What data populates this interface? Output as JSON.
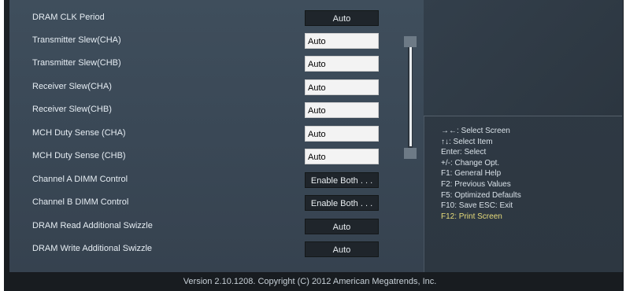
{
  "settings": [
    {
      "label": "DRAM CLK Period",
      "value": "Auto",
      "style": "dark"
    },
    {
      "label": "Transmitter Slew(CHA)",
      "value": "Auto",
      "style": "light"
    },
    {
      "label": "Transmitter Slew(CHB)",
      "value": "Auto",
      "style": "light"
    },
    {
      "label": "Receiver Slew(CHA)",
      "value": "Auto",
      "style": "light"
    },
    {
      "label": "Receiver Slew(CHB)",
      "value": "Auto",
      "style": "light"
    },
    {
      "label": "MCH Duty Sense (CHA)",
      "value": "Auto",
      "style": "light"
    },
    {
      "label": "MCH Duty Sense (CHB)",
      "value": "Auto",
      "style": "light"
    },
    {
      "label": "Channel A DIMM Control",
      "value": "Enable Both . . .",
      "style": "dark"
    },
    {
      "label": "Channel B DIMM Control",
      "value": "Enable Both . . .",
      "style": "dark"
    },
    {
      "label": "DRAM Read Additional Swizzle",
      "value": "Auto",
      "style": "dark"
    },
    {
      "label": "DRAM Write Additional Swizzle",
      "value": "Auto",
      "style": "dark"
    }
  ],
  "help": {
    "select_screen": "→←: Select Screen",
    "select_item": "↑↓: Select Item",
    "enter": "Enter: Select",
    "change": "+/-: Change Opt.",
    "f1": "F1: General Help",
    "f2": "F2: Previous Values",
    "f5": "F5: Optimized Defaults",
    "f10": "F10: Save   ESC: Exit",
    "f12": "F12: Print Screen"
  },
  "footer": {
    "version": "Version  2.10.1208.  Copyright  (C)  2012  American  Megatrends,  Inc."
  },
  "colors": {
    "panel": "#3c4a58",
    "highlight_text": "#e7dc7b",
    "text": "#e6edf3"
  }
}
